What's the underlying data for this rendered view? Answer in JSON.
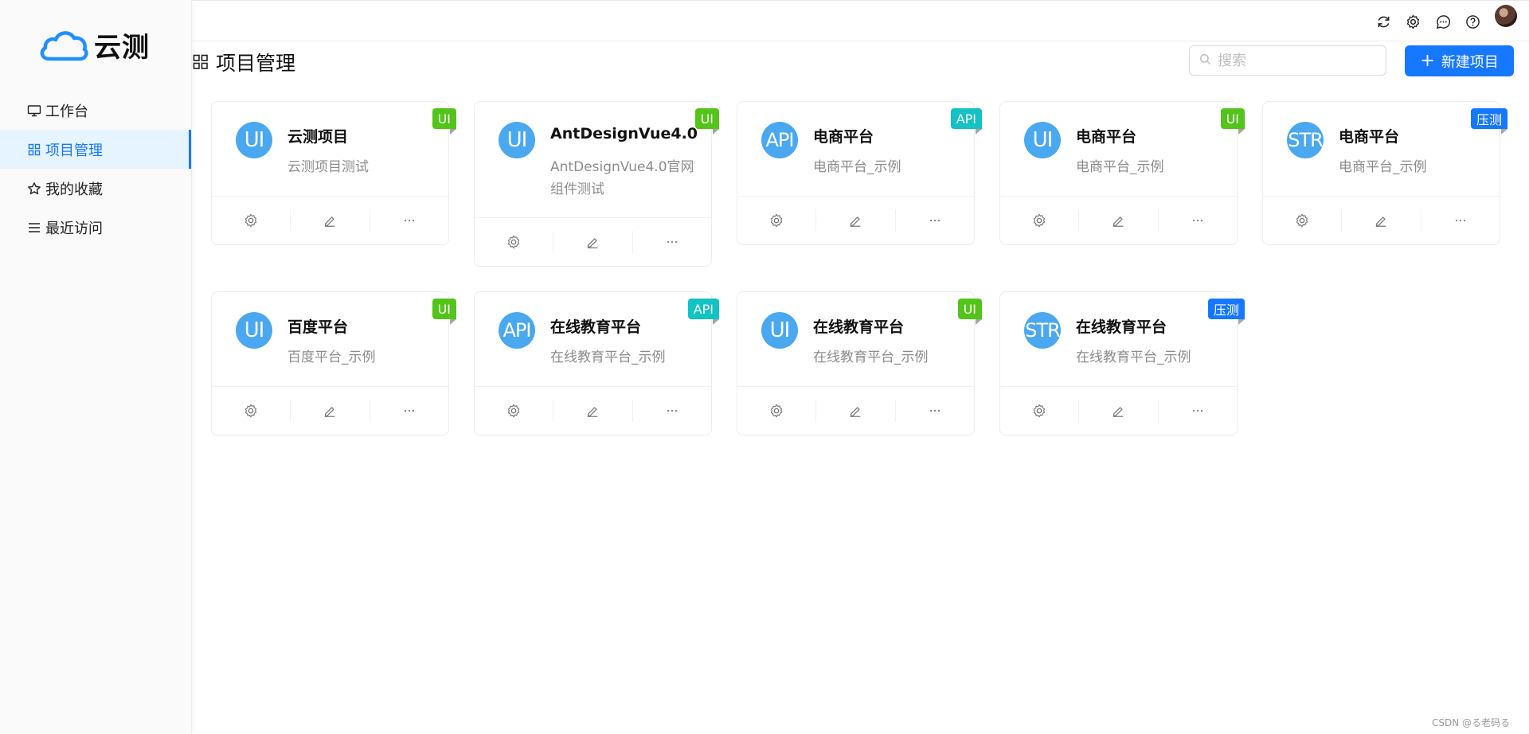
{
  "app": {
    "name": "云测",
    "colors": {
      "primary": "#1677ff",
      "tag_ui": "#52c41a",
      "tag_api": "#13c2c2",
      "tag_str": "#1677ff",
      "avatar": "#4aa8f0"
    }
  },
  "sidebar": {
    "items": [
      {
        "label": "工作台",
        "icon": "desktop-icon",
        "active": false
      },
      {
        "label": "项目管理",
        "icon": "appstore-icon",
        "active": true
      },
      {
        "label": "我的收藏",
        "icon": "star-icon",
        "active": false
      },
      {
        "label": "最近访问",
        "icon": "menu-icon",
        "active": false
      }
    ]
  },
  "header": {
    "icons": [
      "refresh-icon",
      "gear-icon",
      "message-icon",
      "question-icon"
    ]
  },
  "page": {
    "title": "项目管理",
    "search_placeholder": "搜索",
    "new_button_label": "新建项目"
  },
  "projects": [
    {
      "avatar": "UI",
      "title": "云测项目",
      "desc": "云测项目测试",
      "tag": "UI",
      "tag_type": "ui"
    },
    {
      "avatar": "UI",
      "title": "AntDesignVue4.0",
      "desc": "AntDesignVue4.0官网组件测试",
      "tag": "UI",
      "tag_type": "ui"
    },
    {
      "avatar": "API",
      "title": "电商平台",
      "desc": "电商平台_示例",
      "tag": "API",
      "tag_type": "api"
    },
    {
      "avatar": "UI",
      "title": "电商平台",
      "desc": "电商平台_示例",
      "tag": "UI",
      "tag_type": "ui"
    },
    {
      "avatar": "STR",
      "title": "电商平台",
      "desc": "电商平台_示例",
      "tag": "压测",
      "tag_type": "str"
    },
    {
      "avatar": "UI",
      "title": "百度平台",
      "desc": "百度平台_示例",
      "tag": "UI",
      "tag_type": "ui"
    },
    {
      "avatar": "API",
      "title": "在线教育平台",
      "desc": "在线教育平台_示例",
      "tag": "API",
      "tag_type": "api"
    },
    {
      "avatar": "UI",
      "title": "在线教育平台",
      "desc": "在线教育平台_示例",
      "tag": "UI",
      "tag_type": "ui"
    },
    {
      "avatar": "STR",
      "title": "在线教育平台",
      "desc": "在线教育平台_示例",
      "tag": "压测",
      "tag_type": "str"
    }
  ],
  "card_actions": [
    "setting-icon",
    "edit-icon",
    "ellipsis-icon"
  ],
  "footer": "CSDN @る老码る"
}
